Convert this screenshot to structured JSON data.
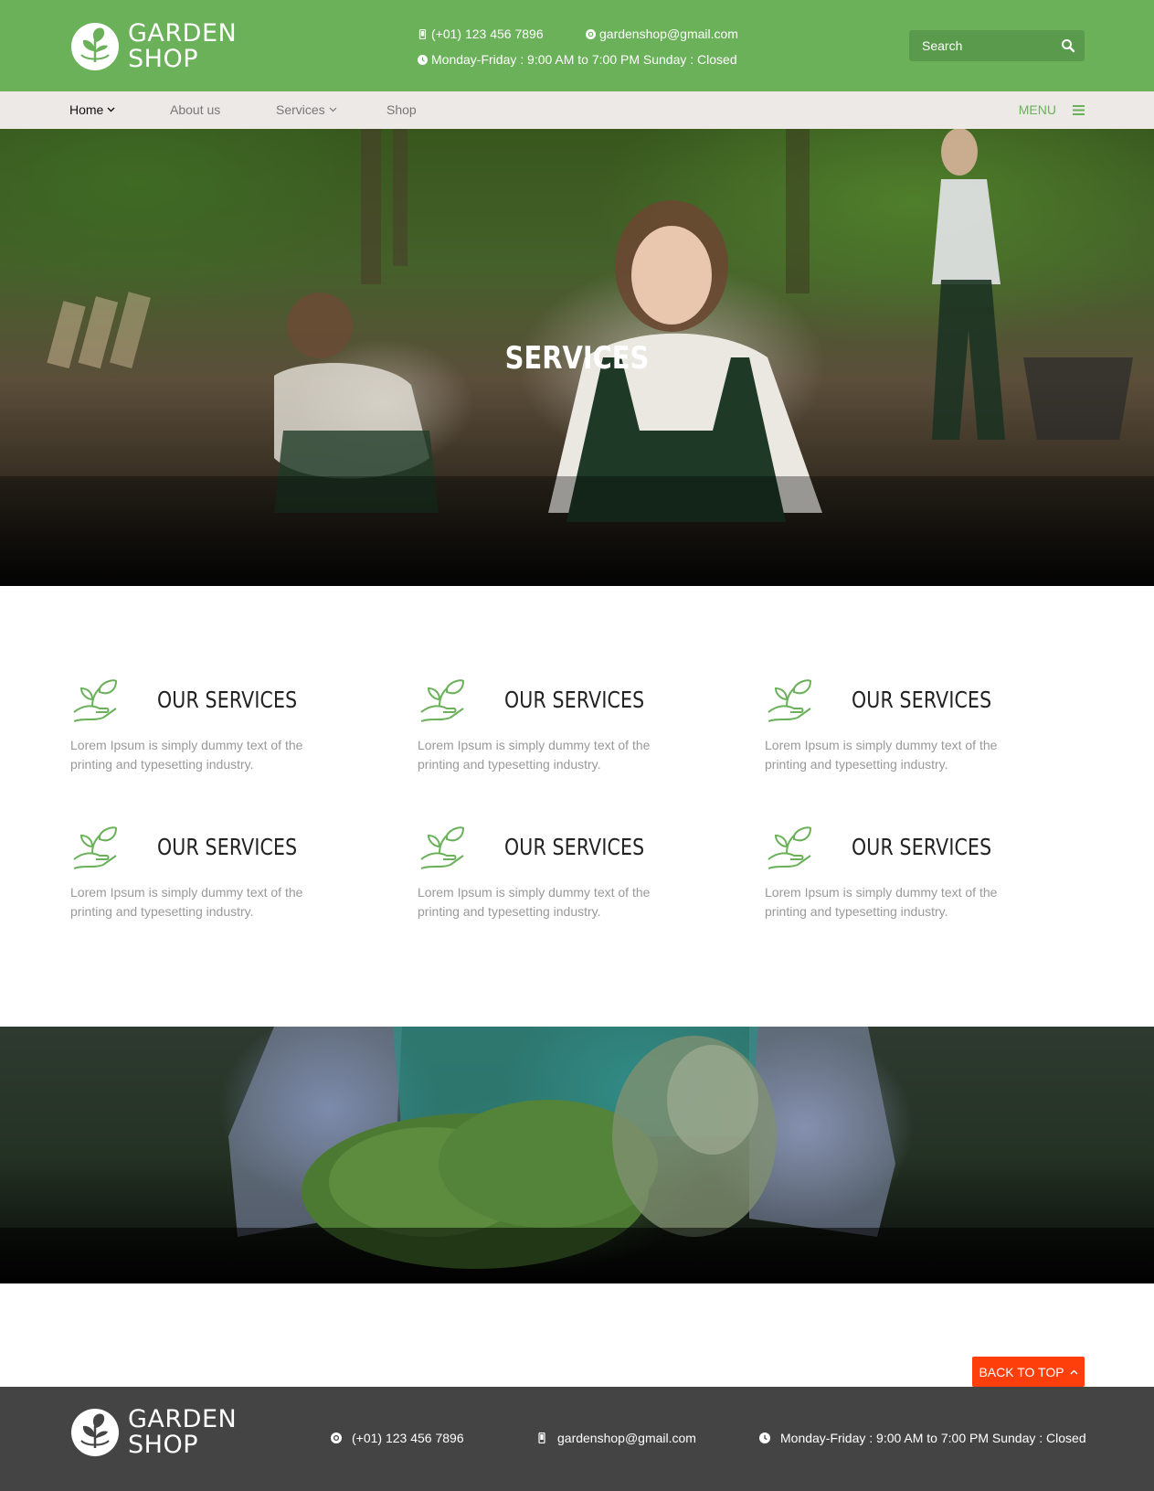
{
  "brand": {
    "line1": "GARDEN",
    "line2": "SHOP"
  },
  "header": {
    "phone": "(+01) 123 456 7896",
    "email": "gardenshop@gmail.com",
    "hours": "Monday-Friday : 9:00 AM to 7:00 PM Sunday : Closed",
    "search_placeholder": "Search"
  },
  "nav": {
    "items": [
      {
        "label": "Home",
        "active": true,
        "dropdown": true
      },
      {
        "label": "About us",
        "active": false,
        "dropdown": false
      },
      {
        "label": "Services",
        "active": false,
        "dropdown": true
      },
      {
        "label": "Shop",
        "active": false,
        "dropdown": false
      }
    ],
    "menu_label": "MENU"
  },
  "hero": {
    "title": "SERVICES"
  },
  "services": [
    {
      "title": "OUR SERVICES",
      "text": "Lorem Ipsum is simply dummy text of the printing and typesetting industry.",
      "icon": "plant-hand-icon"
    },
    {
      "title": "OUR SERVICES",
      "text": "Lorem Ipsum is simply dummy text of the printing and typesetting industry.",
      "icon": "plant-hand-icon"
    },
    {
      "title": "OUR SERVICES",
      "text": "Lorem Ipsum is simply dummy text of the printing and typesetting industry.",
      "icon": "plant-hand-icon"
    },
    {
      "title": "OUR SERVICES",
      "text": "Lorem Ipsum is simply dummy text of the printing and typesetting industry.",
      "icon": "plant-hand-icon"
    },
    {
      "title": "OUR SERVICES",
      "text": "Lorem Ipsum is simply dummy text of the printing and typesetting industry.",
      "icon": "plant-hand-icon"
    },
    {
      "title": "OUR SERVICES",
      "text": "Lorem Ipsum is simply dummy text of the printing and typesetting industry.",
      "icon": "plant-hand-icon"
    }
  ],
  "back_to_top": "BACK TO TOP",
  "footer": {
    "phone": "(+01) 123 456 7896",
    "email": "gardenshop@gmail.com",
    "hours": "Monday-Friday : 9:00 AM to 7:00 PM Sunday : Closed"
  },
  "colors": {
    "brand_green": "#6ab15a",
    "nav_bg": "#ede9e7",
    "footer_bg": "#444444",
    "back_to_top": "#ff3f0b"
  }
}
